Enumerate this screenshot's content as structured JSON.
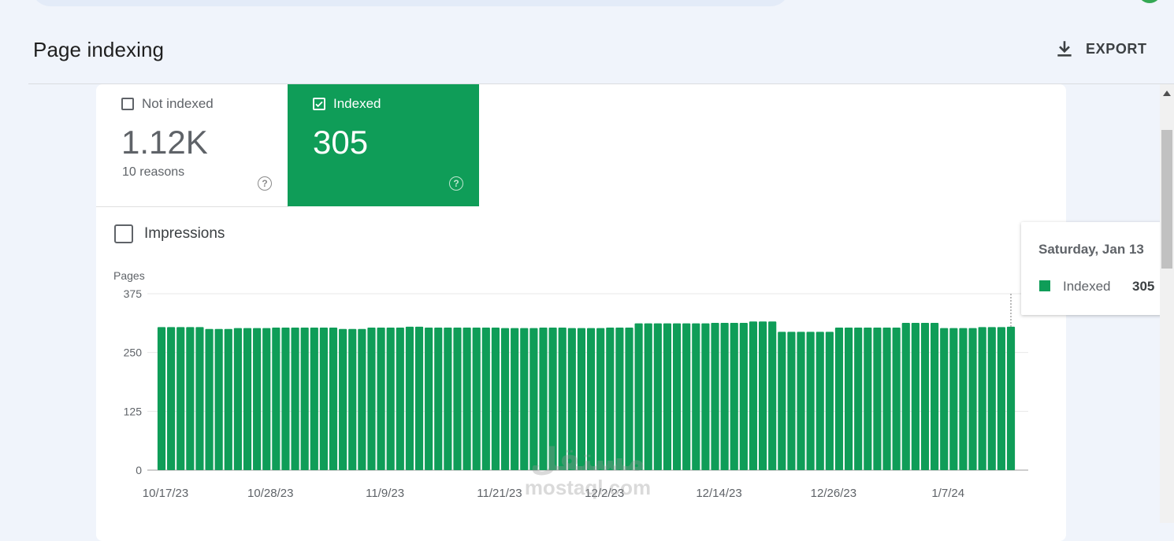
{
  "header": {
    "title": "Page indexing",
    "export_label": "EXPORT"
  },
  "tiles": {
    "not_indexed": {
      "label": "Not indexed",
      "value": "1.12K",
      "sub": "10 reasons",
      "checked": false
    },
    "indexed": {
      "label": "Indexed",
      "value": "305",
      "checked": true
    }
  },
  "impressions": {
    "label": "Impressions",
    "checked": false
  },
  "tooltip": {
    "date": "Saturday, Jan 13",
    "series": "Indexed",
    "value": "305"
  },
  "watermark": {
    "arabic": "مستقل",
    "latin": "mostaql.com"
  },
  "colors": {
    "indexed": "#0f9d58",
    "page_bg": "#f0f4fb"
  },
  "chart_data": {
    "type": "bar",
    "ylabel": "Pages",
    "ylim": [
      0,
      375
    ],
    "yticks": [
      "0",
      "125",
      "250",
      "375"
    ],
    "x_tick_labels": [
      "10/17/23",
      "10/28/23",
      "11/9/23",
      "11/21/23",
      "12/2/23",
      "12/14/23",
      "12/26/23",
      "1/7/24"
    ],
    "x_tick_index": [
      0,
      11,
      23,
      35,
      46,
      58,
      70,
      82
    ],
    "start_index_of_first_label": 0,
    "series": [
      {
        "name": "Indexed",
        "color": "#0f9d58",
        "values": [
          304,
          304,
          304,
          304,
          304,
          300,
          300,
          300,
          302,
          302,
          302,
          302,
          303,
          303,
          303,
          303,
          303,
          303,
          303,
          300,
          300,
          300,
          303,
          303,
          303,
          303,
          305,
          305,
          303,
          303,
          303,
          303,
          303,
          303,
          303,
          303,
          302,
          302,
          302,
          302,
          303,
          303,
          303,
          302,
          302,
          302,
          302,
          303,
          303,
          303,
          312,
          312,
          312,
          312,
          312,
          312,
          312,
          312,
          313,
          313,
          313,
          313,
          316,
          316,
          316,
          294,
          294,
          294,
          294,
          294,
          294,
          303,
          303,
          303,
          303,
          303,
          303,
          303,
          313,
          313,
          313,
          313,
          302,
          302,
          302,
          302,
          304,
          304,
          304,
          305
        ]
      }
    ],
    "highlight_index": 89
  }
}
